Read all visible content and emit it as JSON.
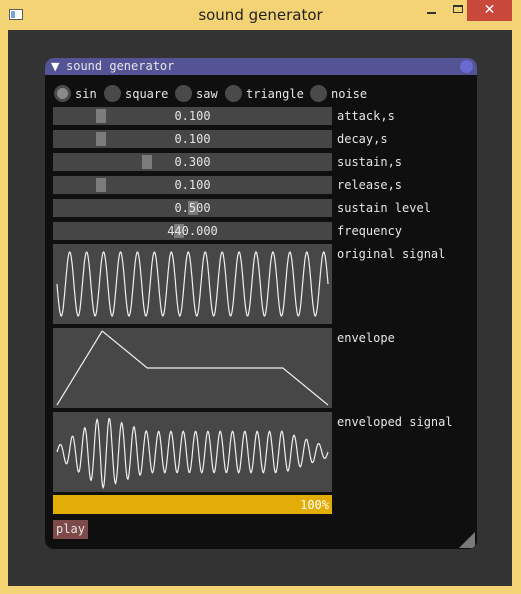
{
  "window": {
    "title": "sound generator",
    "close_glyph": "✕",
    "minimize_icon": "minimize-icon",
    "maximize_icon": "maximize-icon"
  },
  "panel": {
    "title": "sound generator",
    "collapse_glyph": "▼"
  },
  "waveforms": [
    {
      "label": "sin",
      "selected": true
    },
    {
      "label": "square",
      "selected": false
    },
    {
      "label": "saw",
      "selected": false
    },
    {
      "label": "triangle",
      "selected": false
    },
    {
      "label": "noise",
      "selected": false
    }
  ],
  "sliders": [
    {
      "label": "attack,s",
      "value": "0.100",
      "level": 0.1
    },
    {
      "label": "decay,s",
      "value": "0.100",
      "level": 0.1
    },
    {
      "label": "sustain,s",
      "value": "0.300",
      "level": 0.3
    },
    {
      "label": "release,s",
      "value": "0.100",
      "level": 0.1
    },
    {
      "label": "sustain level",
      "value": "0.500",
      "level": 0.5
    },
    {
      "label": "frequency",
      "value": "440.000",
      "level": 0.44
    }
  ],
  "plots": [
    {
      "label": "original signal"
    },
    {
      "label": "envelope"
    },
    {
      "label": "enveloped signal"
    }
  ],
  "progress": {
    "text": "100%",
    "fraction": 1.0
  },
  "play_button": {
    "label": "play"
  },
  "colors": {
    "accent": "#535396",
    "progress": "#e2ad07",
    "button": "#7e4949",
    "plot_bg": "#474747",
    "frame_bg": "#464646"
  }
}
